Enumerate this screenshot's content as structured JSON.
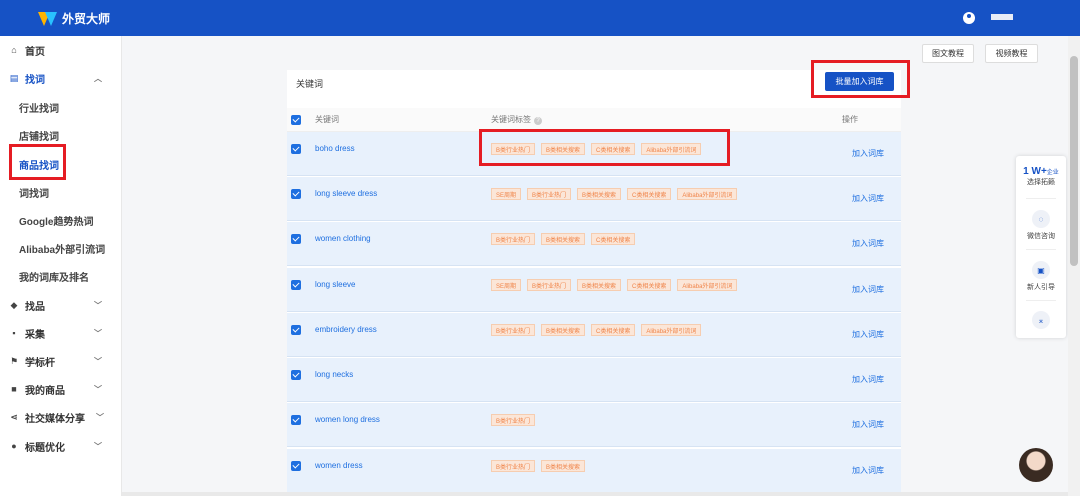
{
  "app": {
    "logo_text": "外贸大师"
  },
  "sidebar": {
    "home": "首页",
    "find_words": "找词",
    "sub_items": [
      "行业找词",
      "店铺找词",
      "商品找词",
      "词找词",
      "Google趋势热词",
      "Alibaba外部引流词",
      "我的词库及排名"
    ],
    "groups": [
      "找品",
      "采集",
      "学标杆",
      "我的商品",
      "社交媒体分享",
      "标题优化"
    ]
  },
  "top_buttons": {
    "tutorial_text": "图文教程",
    "tutorial_video": "视频教程"
  },
  "main": {
    "title": "关键词",
    "batch_button": "批量加入词库",
    "columns": {
      "keyword": "关键词",
      "tags": "关键词标签",
      "action": "操作"
    },
    "rows": [
      {
        "keyword": "boho dress",
        "tags": [
          "B类行业热门",
          "B类相关搜索",
          "C类相关搜索",
          "Alibaba外部引流词"
        ],
        "action": "加入词库"
      },
      {
        "keyword": "long sleeve dress",
        "tags": [
          "SE周期",
          "B类行业热门",
          "B类相关搜索",
          "C类相关搜索",
          "Alibaba外部引流词"
        ],
        "action": "加入词库"
      },
      {
        "keyword": "women clothing",
        "tags": [
          "B类行业热门",
          "B类相关搜索",
          "C类相关搜索"
        ],
        "action": "加入词库"
      },
      {
        "keyword": "long sleeve",
        "tags": [
          "SE周期",
          "B类行业热门",
          "B类相关搜索",
          "C类相关搜索",
          "Alibaba外部引流词"
        ],
        "action": "加入词库"
      },
      {
        "keyword": "embroidery dress",
        "tags": [
          "B类行业热门",
          "B类相关搜索",
          "C类相关搜索",
          "Alibaba外部引流词"
        ],
        "action": "加入词库"
      },
      {
        "keyword": "long necks",
        "tags": [],
        "action": "加入词库"
      },
      {
        "keyword": "women long dress",
        "tags": [
          "B类行业热门"
        ],
        "action": "加入词库"
      },
      {
        "keyword": "women dress",
        "tags": [
          "B类行业热门",
          "B类相关搜索"
        ],
        "action": "加入词库"
      }
    ]
  },
  "float_panel": {
    "top_main": "1 W+",
    "top_small": "企业",
    "top_sub": "选择拓籁",
    "wechat": "微信咨询",
    "guide": "新人引导"
  },
  "colors": {
    "brand": "#1652c5",
    "highlight": "#e51c23",
    "tag_text": "#f08449"
  }
}
